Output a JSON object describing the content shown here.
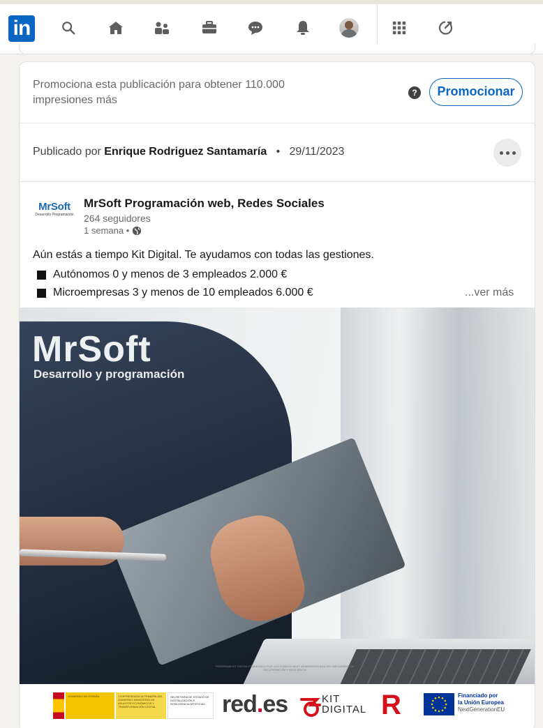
{
  "nav": {
    "logo_text": "in",
    "items": [
      {
        "name": "search-icon"
      },
      {
        "name": "home-icon"
      },
      {
        "name": "my-network-icon"
      },
      {
        "name": "jobs-icon"
      },
      {
        "name": "messaging-icon"
      },
      {
        "name": "notifications-icon"
      },
      {
        "name": "profile-avatar"
      },
      {
        "name": "apps-grid-icon"
      },
      {
        "name": "advertise-icon"
      }
    ],
    "accent": "#0a66c2"
  },
  "promo": {
    "text": "Promociona esta publicación para obtener 110.000 impresiones más",
    "help_label": "?",
    "button_label": "Promocionar"
  },
  "published": {
    "prefix": "Publicado por",
    "author": "Enrique Rodriguez Santamaría",
    "separator": "•",
    "date": "29/11/2023"
  },
  "org": {
    "logo_name": "MrSoft",
    "logo_sub": "Desarrollo Programación",
    "name": "MrSoft Programación web, Redes Sociales",
    "followers": "264 seguidores",
    "time": "1 semana •"
  },
  "post": {
    "text": "Aún estás a tiempo Kit Digital. Te ayudamos con todas las gestiones.",
    "bullets": [
      "Autónomos 0 y menos de 3 empleados 2.000 €",
      "Microempresas 3 y menos de 10 empleados 6.000 €"
    ],
    "see_more": "...ver más"
  },
  "image": {
    "brand_title": "MrSoft",
    "brand_sub": "Desarrollo y programación",
    "fine_print": "PROGRAMA KIT DIGITAL FINANCIADO POR LOS FONDOS NEXT GENERATION (EU) DEL MECANISMO DE RECUPERACIÓN Y RESILIENCIA",
    "gov_1": "GOBIERNO DE ESPAÑA",
    "gov_2": "VICEPRESIDENCIA PRIMERA DEL GOBIERNO MINISTERIO DE ASUNTOS ECONÓMICOS Y TRANSFORMACIÓN DIGITAL",
    "gov_3": "SECRETARÍA DE ESTADO DE DIGITALIZACIÓN E INTELIGENCIA ARTIFICIAL",
    "red_es_a": "red",
    "red_es_dot": ".",
    "red_es_b": "es",
    "kit_line1": "KIT",
    "kit_line2": "DIGITAL",
    "rtr_mark": "R",
    "eu_line1": "Financiado por",
    "eu_line2": "la Unión Europea",
    "eu_line3": "NextGenerationEU"
  }
}
